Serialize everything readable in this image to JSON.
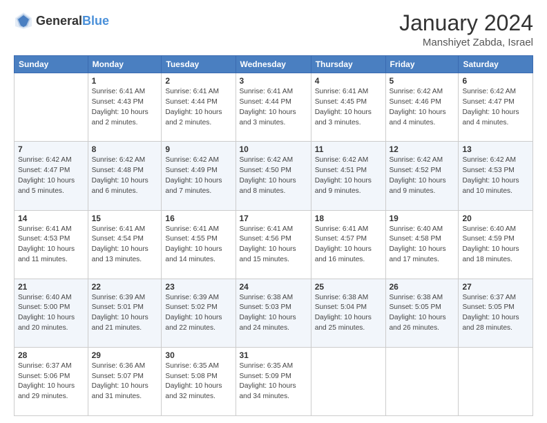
{
  "logo": {
    "general": "General",
    "blue": "Blue"
  },
  "header": {
    "month": "January 2024",
    "location": "Manshiyet Zabda, Israel"
  },
  "weekdays": [
    "Sunday",
    "Monday",
    "Tuesday",
    "Wednesday",
    "Thursday",
    "Friday",
    "Saturday"
  ],
  "weeks": [
    [
      {
        "day": "",
        "sunrise": "",
        "sunset": "",
        "daylight": ""
      },
      {
        "day": "1",
        "sunrise": "Sunrise: 6:41 AM",
        "sunset": "Sunset: 4:43 PM",
        "daylight": "Daylight: 10 hours and 2 minutes."
      },
      {
        "day": "2",
        "sunrise": "Sunrise: 6:41 AM",
        "sunset": "Sunset: 4:44 PM",
        "daylight": "Daylight: 10 hours and 2 minutes."
      },
      {
        "day": "3",
        "sunrise": "Sunrise: 6:41 AM",
        "sunset": "Sunset: 4:44 PM",
        "daylight": "Daylight: 10 hours and 3 minutes."
      },
      {
        "day": "4",
        "sunrise": "Sunrise: 6:41 AM",
        "sunset": "Sunset: 4:45 PM",
        "daylight": "Daylight: 10 hours and 3 minutes."
      },
      {
        "day": "5",
        "sunrise": "Sunrise: 6:42 AM",
        "sunset": "Sunset: 4:46 PM",
        "daylight": "Daylight: 10 hours and 4 minutes."
      },
      {
        "day": "6",
        "sunrise": "Sunrise: 6:42 AM",
        "sunset": "Sunset: 4:47 PM",
        "daylight": "Daylight: 10 hours and 4 minutes."
      }
    ],
    [
      {
        "day": "7",
        "sunrise": "Sunrise: 6:42 AM",
        "sunset": "Sunset: 4:47 PM",
        "daylight": "Daylight: 10 hours and 5 minutes."
      },
      {
        "day": "8",
        "sunrise": "Sunrise: 6:42 AM",
        "sunset": "Sunset: 4:48 PM",
        "daylight": "Daylight: 10 hours and 6 minutes."
      },
      {
        "day": "9",
        "sunrise": "Sunrise: 6:42 AM",
        "sunset": "Sunset: 4:49 PM",
        "daylight": "Daylight: 10 hours and 7 minutes."
      },
      {
        "day": "10",
        "sunrise": "Sunrise: 6:42 AM",
        "sunset": "Sunset: 4:50 PM",
        "daylight": "Daylight: 10 hours and 8 minutes."
      },
      {
        "day": "11",
        "sunrise": "Sunrise: 6:42 AM",
        "sunset": "Sunset: 4:51 PM",
        "daylight": "Daylight: 10 hours and 9 minutes."
      },
      {
        "day": "12",
        "sunrise": "Sunrise: 6:42 AM",
        "sunset": "Sunset: 4:52 PM",
        "daylight": "Daylight: 10 hours and 9 minutes."
      },
      {
        "day": "13",
        "sunrise": "Sunrise: 6:42 AM",
        "sunset": "Sunset: 4:53 PM",
        "daylight": "Daylight: 10 hours and 10 minutes."
      }
    ],
    [
      {
        "day": "14",
        "sunrise": "Sunrise: 6:41 AM",
        "sunset": "Sunset: 4:53 PM",
        "daylight": "Daylight: 10 hours and 11 minutes."
      },
      {
        "day": "15",
        "sunrise": "Sunrise: 6:41 AM",
        "sunset": "Sunset: 4:54 PM",
        "daylight": "Daylight: 10 hours and 13 minutes."
      },
      {
        "day": "16",
        "sunrise": "Sunrise: 6:41 AM",
        "sunset": "Sunset: 4:55 PM",
        "daylight": "Daylight: 10 hours and 14 minutes."
      },
      {
        "day": "17",
        "sunrise": "Sunrise: 6:41 AM",
        "sunset": "Sunset: 4:56 PM",
        "daylight": "Daylight: 10 hours and 15 minutes."
      },
      {
        "day": "18",
        "sunrise": "Sunrise: 6:41 AM",
        "sunset": "Sunset: 4:57 PM",
        "daylight": "Daylight: 10 hours and 16 minutes."
      },
      {
        "day": "19",
        "sunrise": "Sunrise: 6:40 AM",
        "sunset": "Sunset: 4:58 PM",
        "daylight": "Daylight: 10 hours and 17 minutes."
      },
      {
        "day": "20",
        "sunrise": "Sunrise: 6:40 AM",
        "sunset": "Sunset: 4:59 PM",
        "daylight": "Daylight: 10 hours and 18 minutes."
      }
    ],
    [
      {
        "day": "21",
        "sunrise": "Sunrise: 6:40 AM",
        "sunset": "Sunset: 5:00 PM",
        "daylight": "Daylight: 10 hours and 20 minutes."
      },
      {
        "day": "22",
        "sunrise": "Sunrise: 6:39 AM",
        "sunset": "Sunset: 5:01 PM",
        "daylight": "Daylight: 10 hours and 21 minutes."
      },
      {
        "day": "23",
        "sunrise": "Sunrise: 6:39 AM",
        "sunset": "Sunset: 5:02 PM",
        "daylight": "Daylight: 10 hours and 22 minutes."
      },
      {
        "day": "24",
        "sunrise": "Sunrise: 6:38 AM",
        "sunset": "Sunset: 5:03 PM",
        "daylight": "Daylight: 10 hours and 24 minutes."
      },
      {
        "day": "25",
        "sunrise": "Sunrise: 6:38 AM",
        "sunset": "Sunset: 5:04 PM",
        "daylight": "Daylight: 10 hours and 25 minutes."
      },
      {
        "day": "26",
        "sunrise": "Sunrise: 6:38 AM",
        "sunset": "Sunset: 5:05 PM",
        "daylight": "Daylight: 10 hours and 26 minutes."
      },
      {
        "day": "27",
        "sunrise": "Sunrise: 6:37 AM",
        "sunset": "Sunset: 5:05 PM",
        "daylight": "Daylight: 10 hours and 28 minutes."
      }
    ],
    [
      {
        "day": "28",
        "sunrise": "Sunrise: 6:37 AM",
        "sunset": "Sunset: 5:06 PM",
        "daylight": "Daylight: 10 hours and 29 minutes."
      },
      {
        "day": "29",
        "sunrise": "Sunrise: 6:36 AM",
        "sunset": "Sunset: 5:07 PM",
        "daylight": "Daylight: 10 hours and 31 minutes."
      },
      {
        "day": "30",
        "sunrise": "Sunrise: 6:35 AM",
        "sunset": "Sunset: 5:08 PM",
        "daylight": "Daylight: 10 hours and 32 minutes."
      },
      {
        "day": "31",
        "sunrise": "Sunrise: 6:35 AM",
        "sunset": "Sunset: 5:09 PM",
        "daylight": "Daylight: 10 hours and 34 minutes."
      },
      {
        "day": "",
        "sunrise": "",
        "sunset": "",
        "daylight": ""
      },
      {
        "day": "",
        "sunrise": "",
        "sunset": "",
        "daylight": ""
      },
      {
        "day": "",
        "sunrise": "",
        "sunset": "",
        "daylight": ""
      }
    ]
  ]
}
